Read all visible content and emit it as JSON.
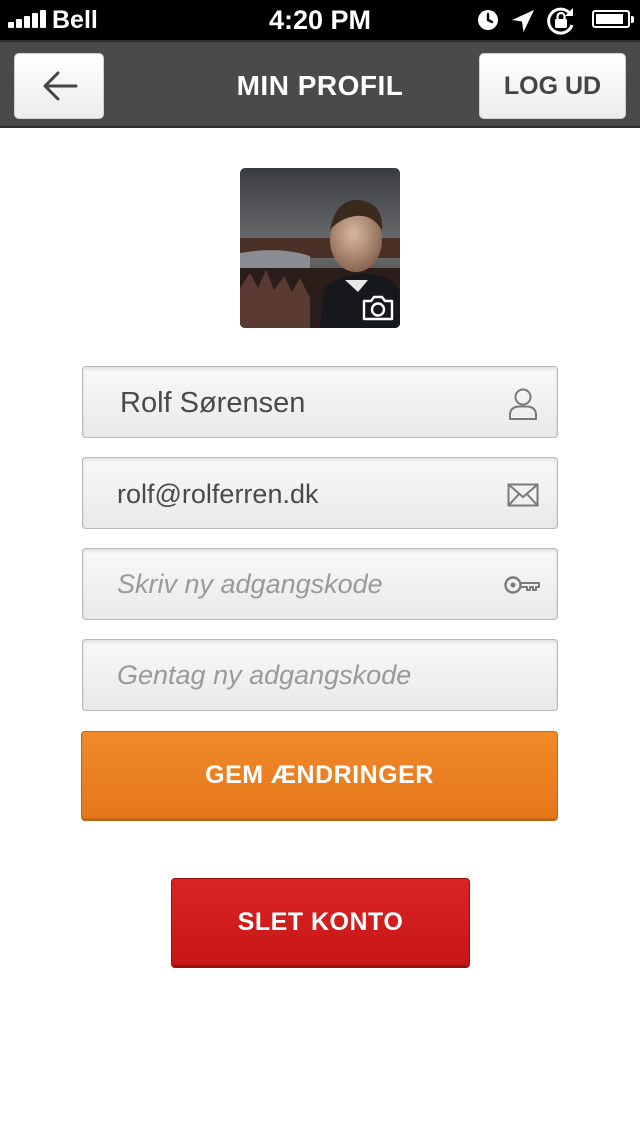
{
  "status_bar": {
    "carrier": "Bell",
    "time": "4:20 PM",
    "signal_bars": 5,
    "battery_level": 0.9,
    "icons": [
      "signal-icon",
      "alarm-icon",
      "location-icon",
      "rotation-lock-icon",
      "battery-icon"
    ]
  },
  "nav": {
    "title": "MIN PROFIL",
    "back_icon": "arrow-left-icon",
    "logout_label": "LOG UD"
  },
  "profile": {
    "avatar_icon": "camera-icon",
    "name_value": "Rolf Sørensen",
    "name_icon": "user-icon",
    "email_value": "rolf@rolferren.dk",
    "email_icon": "mail-icon",
    "password_placeholder": "Skriv ny adgangskode",
    "password_icon": "key-icon",
    "repeat_password_placeholder": "Gentag ny adgangskode"
  },
  "actions": {
    "save_label": "GEM ÆNDRINGER",
    "delete_label": "SLET KONTO"
  },
  "colors": {
    "nav_background": "#4a4a4a",
    "save_button": "#ec8222",
    "delete_button": "#d01d1d"
  }
}
